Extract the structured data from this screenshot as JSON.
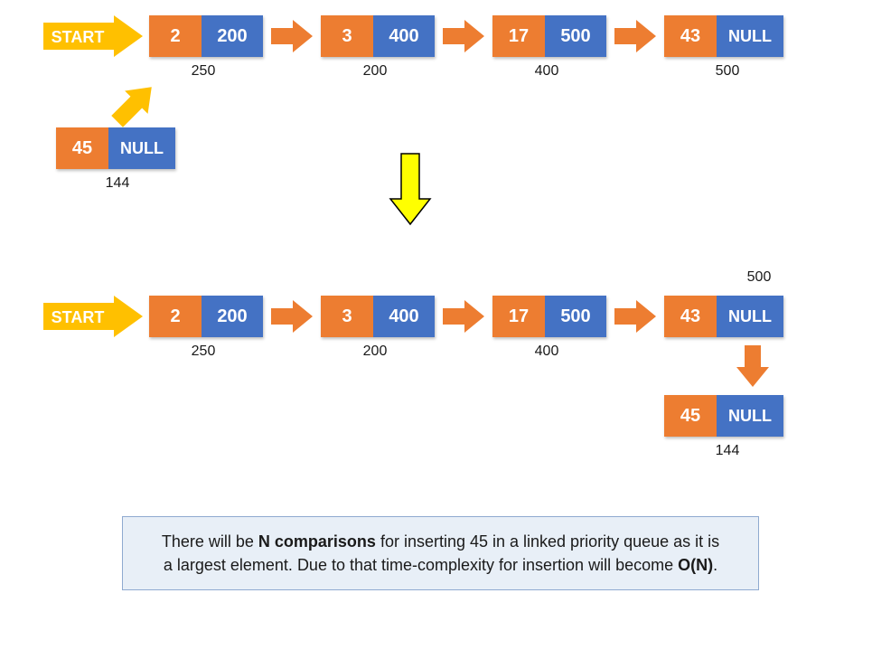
{
  "colors": {
    "orange": "#ed7d31",
    "blue": "#4472c4",
    "amber": "#ffc000",
    "yellow": "#ffff00",
    "captionBg": "#e8eff7",
    "captionBorder": "#8faad0"
  },
  "labels": {
    "start": "START",
    "null": "NULL"
  },
  "row1": {
    "nodes": [
      {
        "data": "2",
        "ptr": "200",
        "addr": "250"
      },
      {
        "data": "3",
        "ptr": "400",
        "addr": "200"
      },
      {
        "data": "17",
        "ptr": "500",
        "addr": "400"
      },
      {
        "data": "43",
        "ptr": "NULL",
        "addr": "500"
      }
    ],
    "new_node": {
      "data": "45",
      "ptr": "NULL",
      "addr": "144"
    }
  },
  "row2": {
    "nodes": [
      {
        "data": "2",
        "ptr": "200",
        "addr": "250"
      },
      {
        "data": "3",
        "ptr": "400",
        "addr": "200"
      },
      {
        "data": "17",
        "ptr": "500",
        "addr": "400"
      },
      {
        "data": "43",
        "ptr": "NULL",
        "addr_above": "500"
      }
    ],
    "appended": {
      "data": "45",
      "ptr": "NULL",
      "addr": "144"
    }
  },
  "caption": {
    "pre": "There will be ",
    "bold1": "N comparisons",
    "mid": " for inserting 45 in a linked priority queue as it is a largest element. Due to that time-complexity for insertion will become ",
    "bold2": "O(N)",
    "post": "."
  }
}
